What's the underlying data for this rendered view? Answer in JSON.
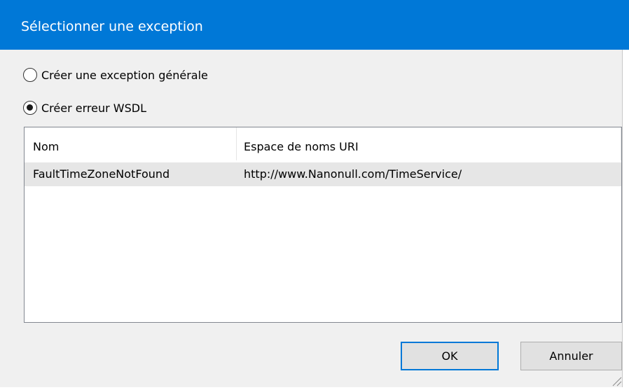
{
  "window": {
    "title": "Sélectionner une exception"
  },
  "options": {
    "general_label": "Créer une exception générale",
    "wsdl_label": "Créer erreur WSDL",
    "selected": "wsdl"
  },
  "table": {
    "columns": [
      "Nom",
      "Espace de noms URI"
    ],
    "rows": [
      [
        "FaultTimeZoneNotFound",
        "http://www.Nanonull.com/TimeService/"
      ]
    ]
  },
  "buttons": {
    "ok_label": "OK",
    "cancel_label": "Annuler"
  },
  "colors": {
    "accent": "#0078d7",
    "selected_row": "#e6e6e6"
  }
}
